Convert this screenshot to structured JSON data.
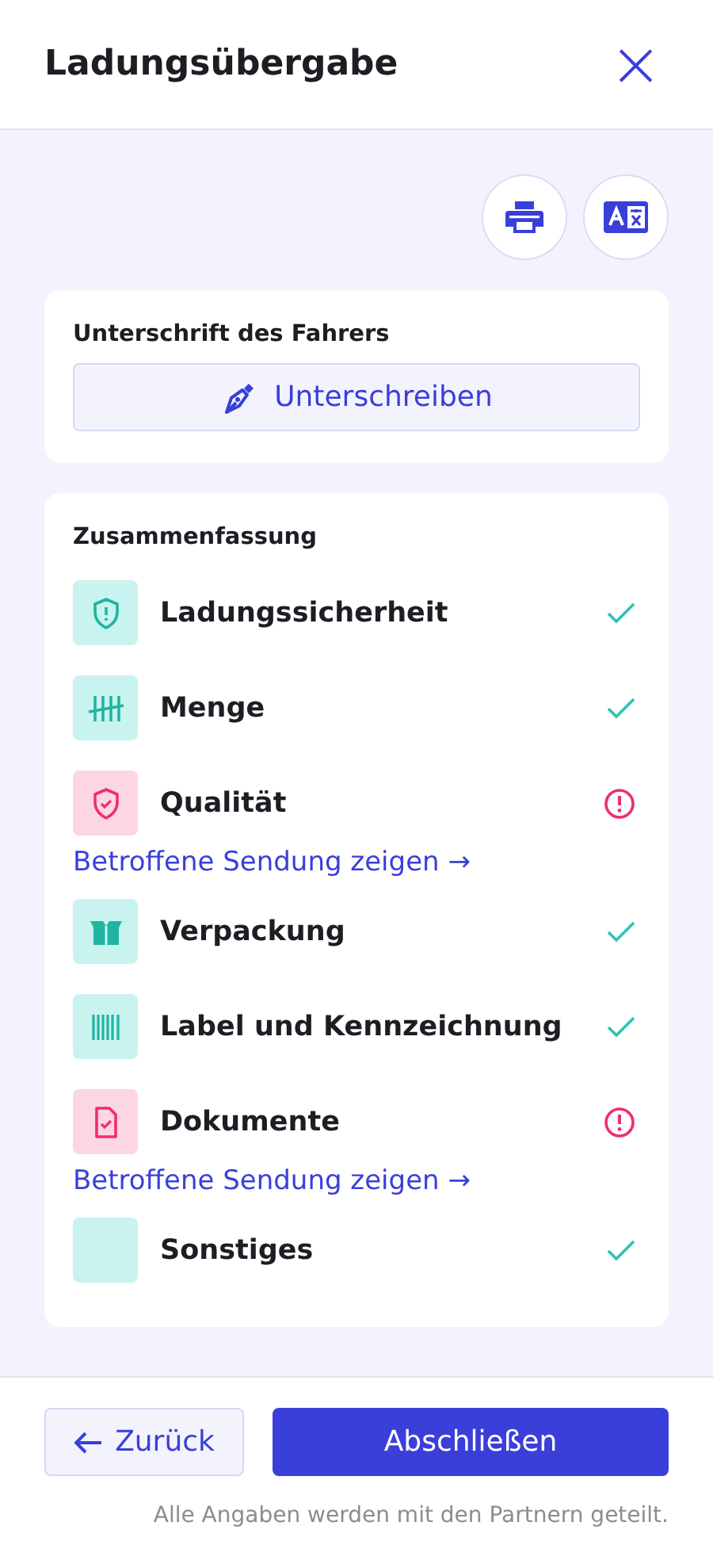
{
  "header": {
    "title": "Ladungsübergabe",
    "close": "×"
  },
  "signature": {
    "title": "Unterschrift des Fahrers",
    "button": "Unterschreiben"
  },
  "summary": {
    "title": "Zusammenfassung",
    "items": [
      {
        "label": "Ladungssicherheit",
        "issue": false
      },
      {
        "label": "Menge",
        "issue": false
      },
      {
        "label": "Qualität",
        "issue": true,
        "link": "Betroffene Sendung zeigen →"
      },
      {
        "label": "Verpackung",
        "issue": false
      },
      {
        "label": "Label und Kennzeichnung",
        "issue": false
      },
      {
        "label": "Dokumente",
        "issue": true,
        "link": "Betroffene Sendung zeigen →"
      },
      {
        "label": "Sonstiges",
        "issue": false
      }
    ]
  },
  "footer": {
    "back": "Zurück",
    "finish": "Abschließen",
    "note": "Alle Angaben werden mit den Partnern geteilt."
  }
}
